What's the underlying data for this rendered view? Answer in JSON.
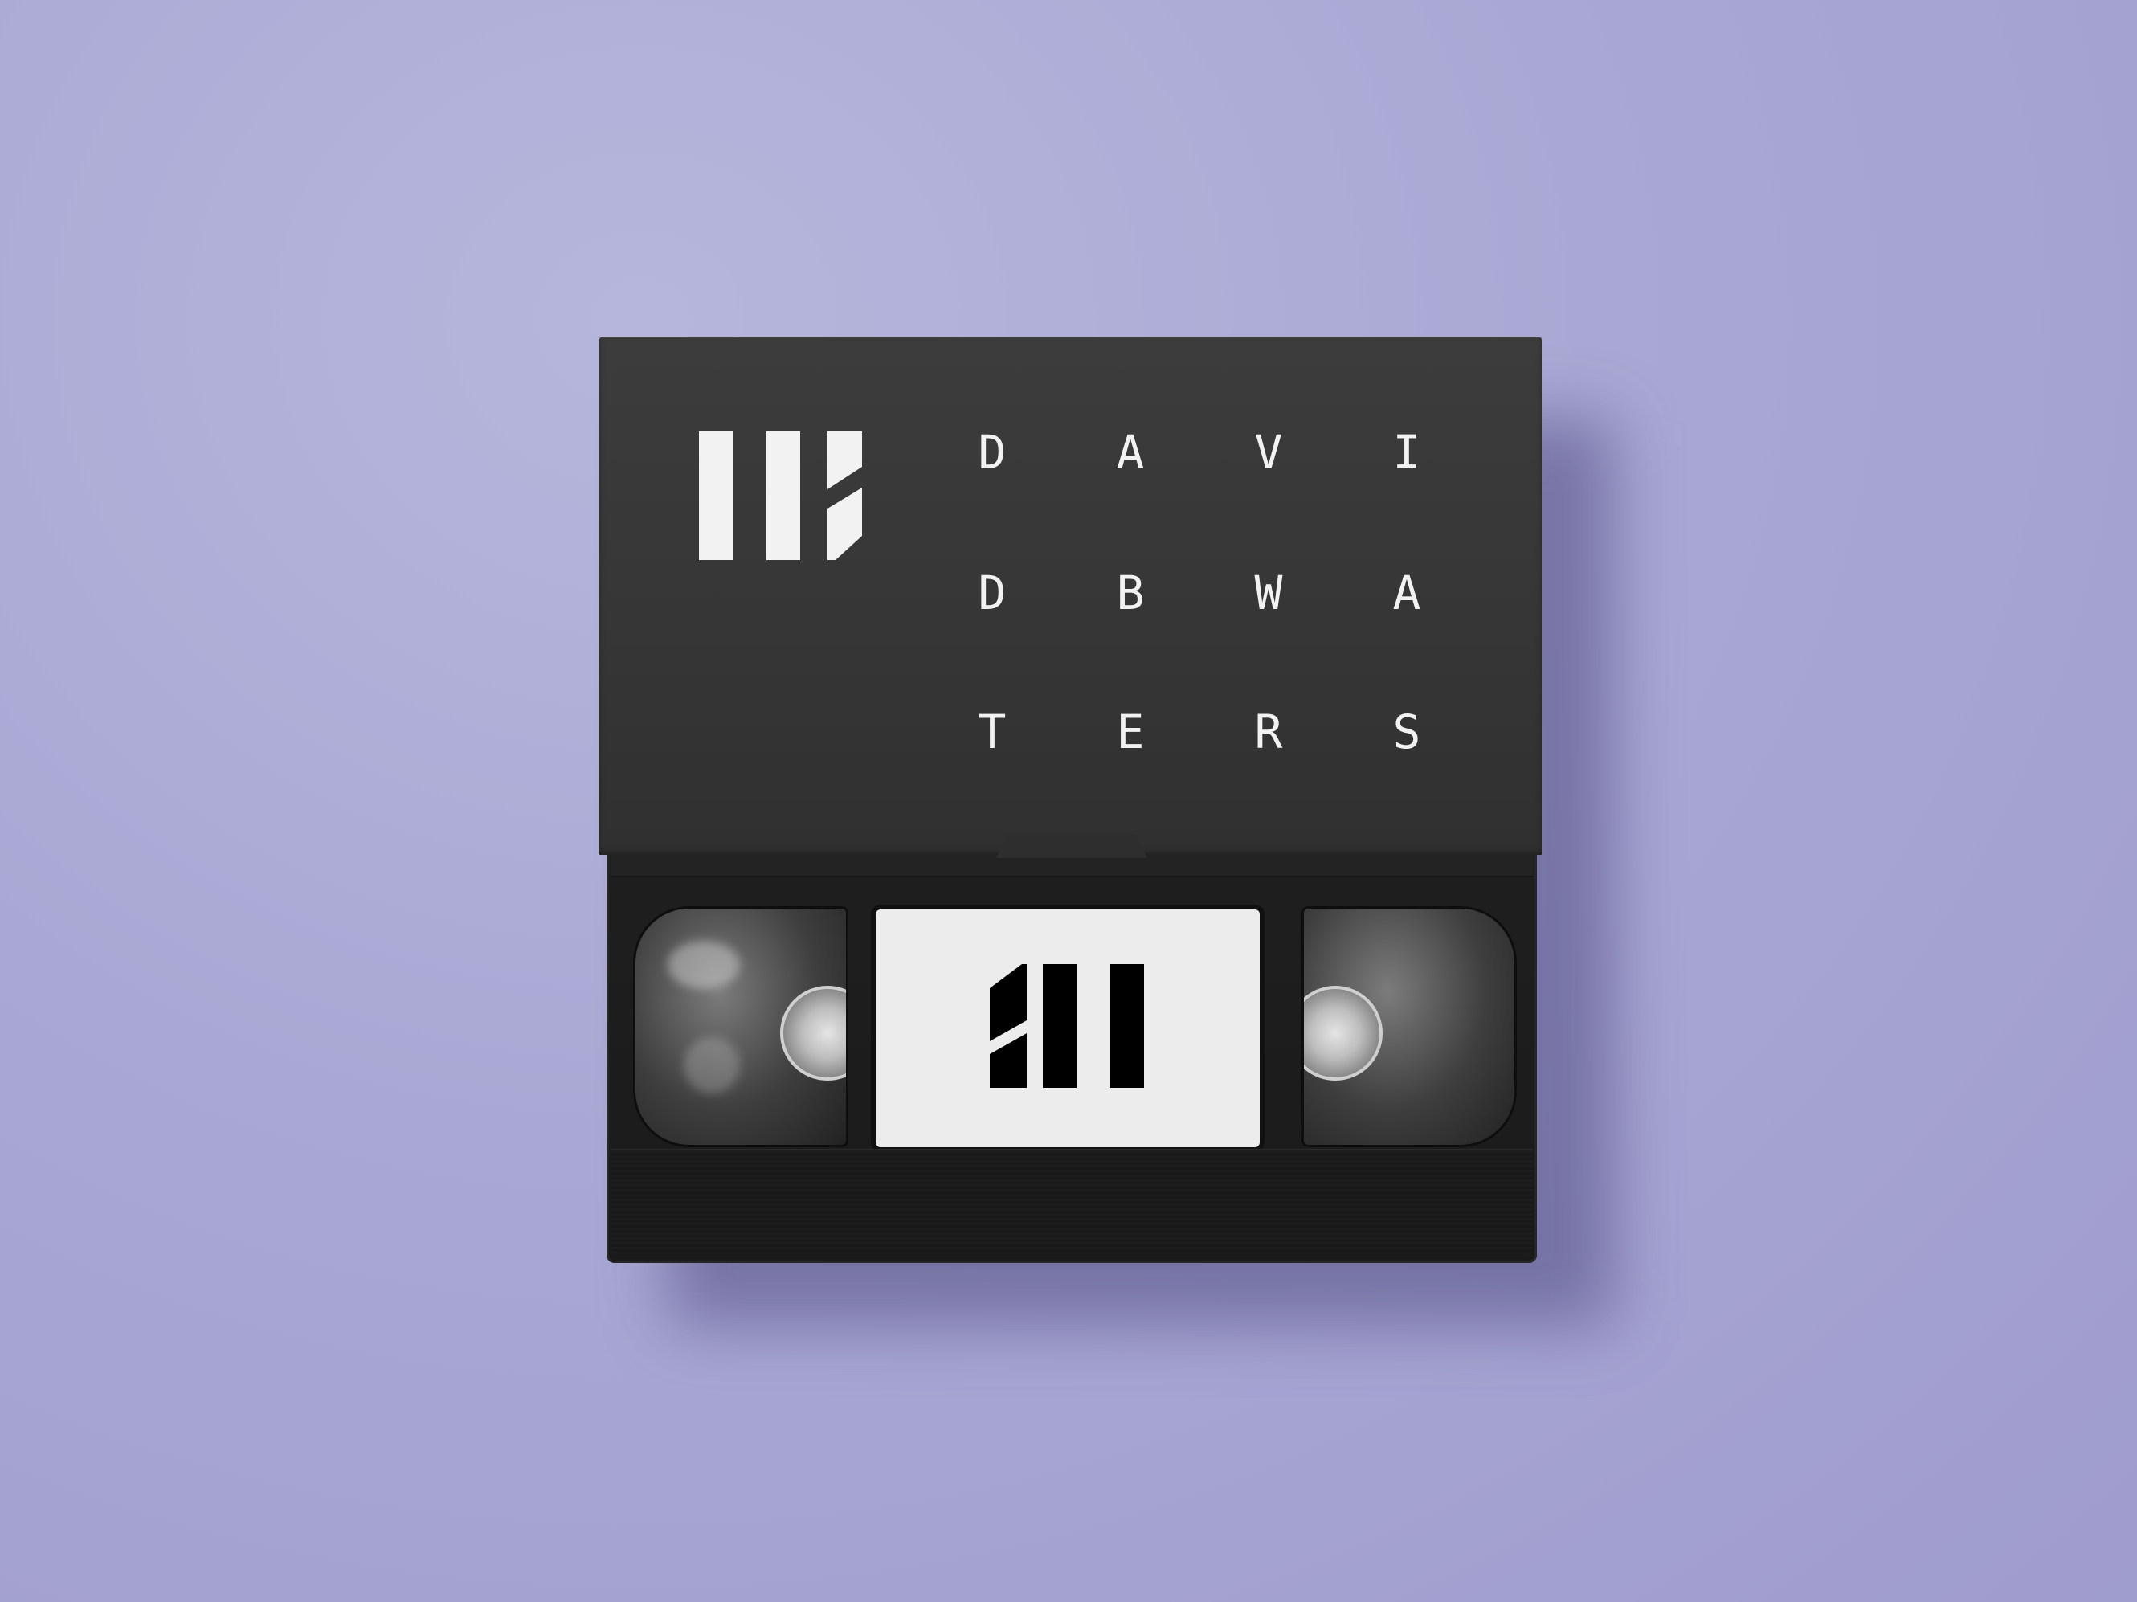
{
  "sleeve": {
    "name_letters": [
      "D",
      "A",
      "V",
      "I",
      "D",
      "B",
      "W",
      "A",
      "T",
      "E",
      "R",
      "S"
    ]
  },
  "colors": {
    "background": "#a9a8d4",
    "sleeve": "#363636",
    "cassette": "#1c1c1c",
    "label": "#ececec",
    "logo_on_sleeve": "#f2f2f2",
    "logo_on_label": "#000000"
  },
  "icons": {
    "sleeve_logo": "dbw-monogram-icon",
    "label_logo": "dbw-monogram-icon"
  }
}
